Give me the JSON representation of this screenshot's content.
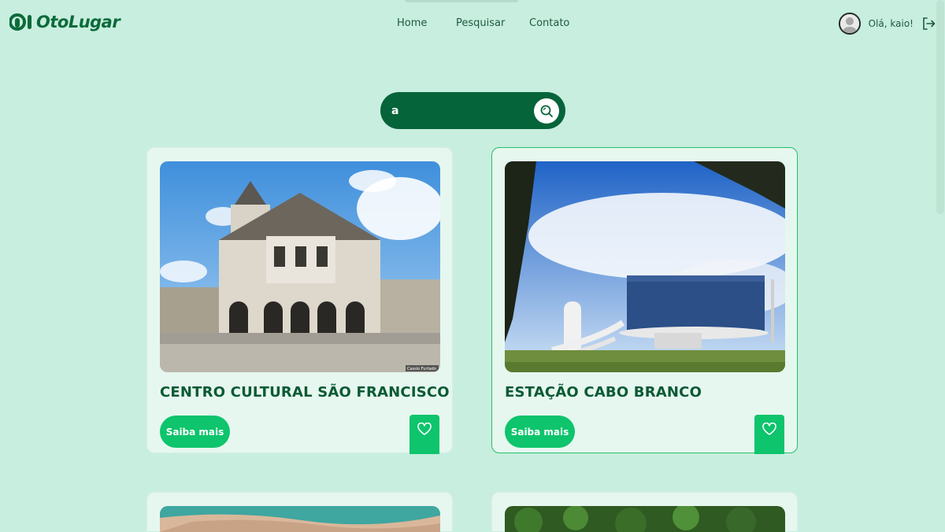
{
  "brand": {
    "name": "OtoLugar"
  },
  "nav": {
    "items": [
      "Home",
      "Pesquisar",
      "Contato"
    ]
  },
  "user": {
    "greeting": "Olá, kaio!"
  },
  "search": {
    "value": "a"
  },
  "cards": [
    {
      "title": "CENTRO CULTURAL SÃO FRANCISCO",
      "button_label": "Saiba mais",
      "image_credit": "Cassio Furtado"
    },
    {
      "title": "ESTAÇÃO CABO BRANCO",
      "button_label": "Saiba mais"
    }
  ],
  "colors": {
    "background": "#c8eedf",
    "primary_dark": "#06643a",
    "accent": "#0ec46c",
    "card": "#e6f7ef"
  },
  "icons": {
    "search": "search-icon",
    "favorite": "heart-icon",
    "logout": "logout-icon",
    "avatar": "user-avatar"
  }
}
